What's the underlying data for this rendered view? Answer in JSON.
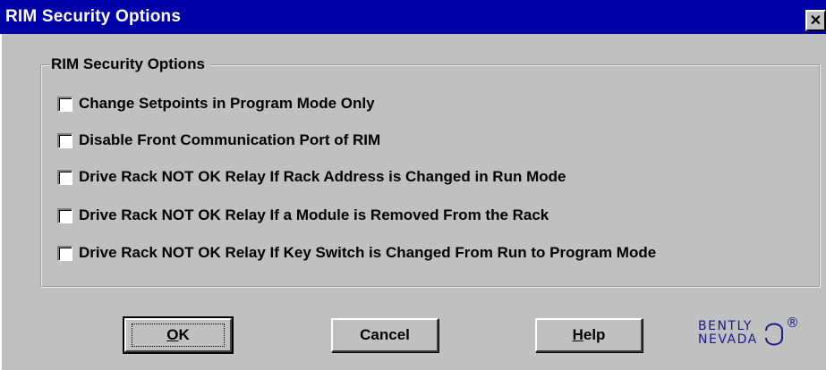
{
  "window": {
    "title": "RIM Security Options",
    "close_glyph": "✕"
  },
  "group": {
    "title": "RIM Security Options",
    "options": [
      {
        "label": "Change Setpoints in Program Mode Only",
        "checked": false
      },
      {
        "label": "Disable Front Communication Port of RIM",
        "checked": false
      },
      {
        "label": "Drive Rack NOT OK Relay If Rack Address is Changed in Run Mode",
        "checked": false
      },
      {
        "label": "Drive Rack NOT OK Relay If a Module is Removed From the Rack",
        "checked": false
      },
      {
        "label": "Drive Rack NOT OK Relay If Key Switch is Changed From Run to Program Mode",
        "checked": false
      }
    ]
  },
  "buttons": {
    "ok_mnemonic": "O",
    "ok_rest": "K",
    "cancel": "Cancel",
    "help_mnemonic": "H",
    "help_rest": "elp"
  },
  "logo": {
    "line1": "BENTLY",
    "line2": "NEVADA",
    "reg": "®"
  },
  "colors": {
    "titlebar": "#0000a8",
    "face": "#c0c0c0",
    "logo": "#1a1a8c"
  }
}
